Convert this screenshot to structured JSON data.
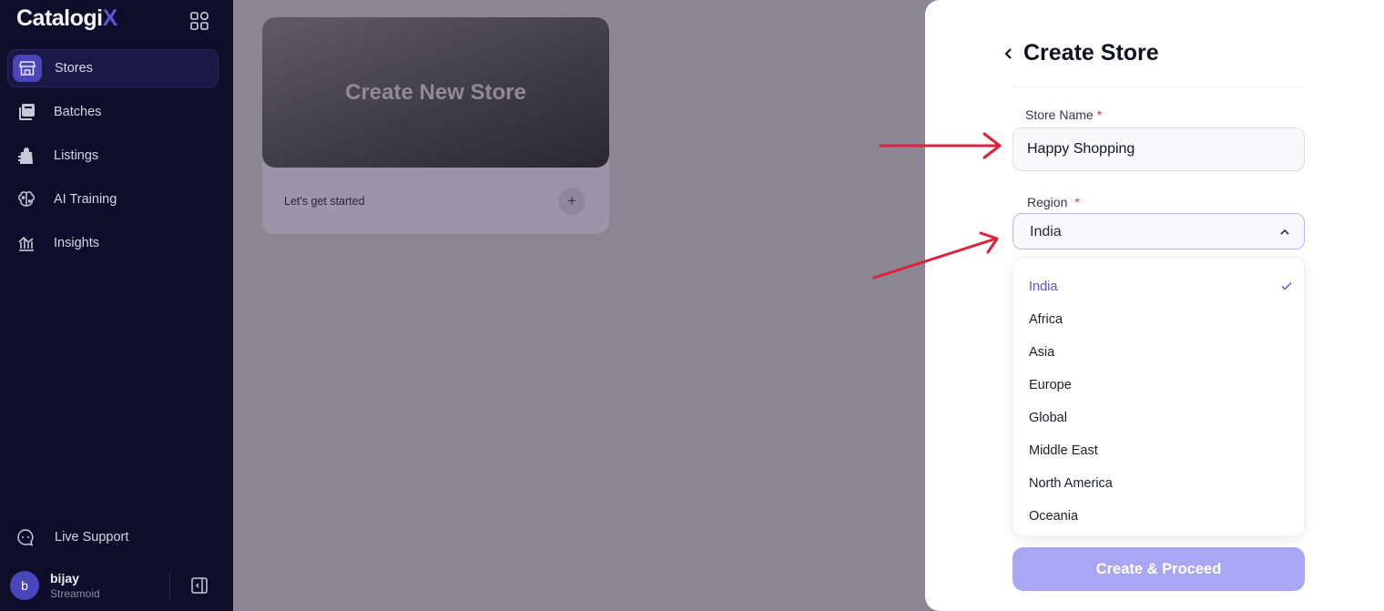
{
  "brand": {
    "name_main": "Catalogi",
    "name_accent": "X",
    "accent_color": "#5b57d9"
  },
  "sidebar": {
    "items": [
      {
        "label": "Stores",
        "icon": "store-icon",
        "active": true
      },
      {
        "label": "Batches",
        "icon": "batches-icon",
        "active": false
      },
      {
        "label": "Listings",
        "icon": "listings-icon",
        "active": false
      },
      {
        "label": "AI Training",
        "icon": "brain-icon",
        "active": false
      },
      {
        "label": "Insights",
        "icon": "insights-icon",
        "active": false
      }
    ],
    "support_label": "Live Support",
    "user": {
      "initial": "b",
      "name": "bijay",
      "org": "Streamoid"
    }
  },
  "main": {
    "card": {
      "title": "Create New Store",
      "subtitle": "Let's get started",
      "plus": "+"
    }
  },
  "panel": {
    "title": "Create Store",
    "store_name": {
      "label": "Store Name",
      "required": "*",
      "value": "Happy Shopping"
    },
    "region": {
      "label": "Region",
      "required": "*",
      "selected": "India",
      "options": [
        "India",
        "Africa",
        "Asia",
        "Europe",
        "Global",
        "Middle East",
        "North America",
        "Oceania"
      ]
    },
    "cta_label": "Create & Proceed"
  },
  "colors": {
    "sidebar_bg": "#0e0d2a",
    "cta": "#a9a6f4",
    "selected_option": "#5553d8",
    "required": "#e0334a",
    "arrow": "#e0203a"
  }
}
